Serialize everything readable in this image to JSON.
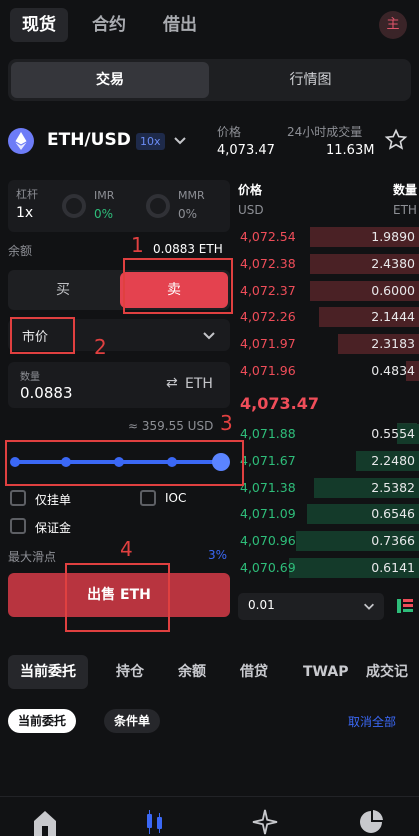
{
  "top_tabs": [
    "现货",
    "合约",
    "借出"
  ],
  "avatar_text": "主",
  "segment": {
    "trade": "交易",
    "market": "行情图"
  },
  "pair": {
    "name": "ETH/USD",
    "leverage": "10x"
  },
  "ticker": {
    "price_label": "价格",
    "price_value": "4,073.47",
    "volume_label": "24小时成交量",
    "volume_value": "11.63M"
  },
  "leverage_box": {
    "label": "杠杆",
    "value": "1x",
    "imr_label": "IMR",
    "imr_value": "0%",
    "mmr_label": "MMR",
    "mmr_value": "0%"
  },
  "balance": {
    "label": "余额",
    "value": "0.0883 ETH"
  },
  "side": {
    "buy": "买",
    "sell": "卖"
  },
  "order_type": "市价",
  "quantity": {
    "label": "数量",
    "value": "0.0883",
    "unit": "ETH"
  },
  "usd_estimate": "≈ 359.55 USD",
  "slider_level": 1.0,
  "options": {
    "post_only": "仅挂单",
    "ioc": "IOC",
    "margin": "保证金"
  },
  "slippage": {
    "label": "最大滑点",
    "value": "3%"
  },
  "sell_button": "出售 ETH",
  "book": {
    "price_header": "价格",
    "price_unit": "USD",
    "qty_header": "数量",
    "qty_unit": "ETH",
    "asks": [
      {
        "price": "4,072.54",
        "qty": "1.9890",
        "fill": 0.6
      },
      {
        "price": "4,072.38",
        "qty": "2.4380",
        "fill": 0.6
      },
      {
        "price": "4,072.37",
        "qty": "0.6000",
        "fill": 0.6
      },
      {
        "price": "4,072.26",
        "qty": "2.1444",
        "fill": 0.55
      },
      {
        "price": "4,071.97",
        "qty": "2.3183",
        "fill": 0.45
      },
      {
        "price": "4,071.96",
        "qty": "0.4834",
        "fill": 0.07
      }
    ],
    "mid": "4,073.47",
    "bids": [
      {
        "price": "4,071.88",
        "qty": "0.5554",
        "fill": 0.12
      },
      {
        "price": "4,071.67",
        "qty": "2.2480",
        "fill": 0.35
      },
      {
        "price": "4,071.38",
        "qty": "2.5382",
        "fill": 0.58
      },
      {
        "price": "4,071.09",
        "qty": "0.6546",
        "fill": 0.62
      },
      {
        "price": "4,070.96",
        "qty": "0.7366",
        "fill": 0.68
      },
      {
        "price": "4,070.69",
        "qty": "0.6141",
        "fill": 0.72
      }
    ],
    "depth": "0.01"
  },
  "position_tabs": [
    "当前委托",
    "持仓",
    "余额",
    "借贷",
    "TWAP",
    "成交记"
  ],
  "order_filters": {
    "current": "当前委托",
    "conditional": "条件单",
    "cancel_all": "取消全部"
  },
  "annotations": [
    "1",
    "2",
    "3",
    "4"
  ],
  "colors": {
    "sell": "#e4424f",
    "buy_green": "#2ebd7a",
    "accent": "#3b68f5",
    "annotation": "#e04040"
  }
}
